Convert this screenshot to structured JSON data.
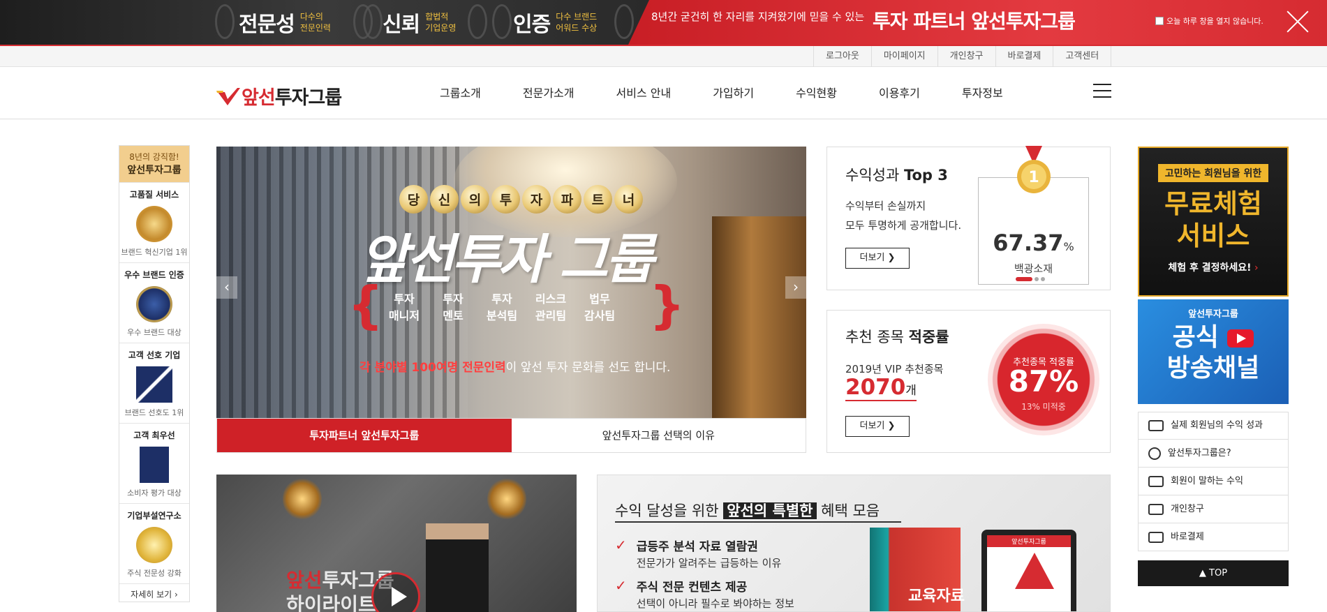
{
  "top_banner": {
    "items": [
      {
        "big": "전문성",
        "small": "다수의\n전문인력"
      },
      {
        "big": "신뢰",
        "small": "합법적\n기업운영"
      },
      {
        "big": "인증",
        "small": "다수 브랜드\n어워드 수상"
      }
    ],
    "message": "8년간 굳건히 한 자리를 지켜왔기에 믿을 수 있는",
    "brand": "투자 파트너 앞선투자그룹",
    "checkbox_label": "오늘 하루 창을 열지 않습니다."
  },
  "util_nav": [
    "로그아웃",
    "마이페이지",
    "개인창구",
    "바로결제",
    "고객센터"
  ],
  "logo": {
    "red": "앞선",
    "black": "투자그룹"
  },
  "gnb": [
    "그룹소개",
    "전문가소개",
    "서비스 안내",
    "가입하기",
    "수익현황",
    "이용후기",
    "투자정보"
  ],
  "left_quick": {
    "head_small": "8년의 강직함!",
    "head_big": "앞선투자그룹",
    "items": [
      {
        "title": "고품질 서비스",
        "sub": "브랜드 혁신기업 1위"
      },
      {
        "title": "우수 브랜드 인증",
        "sub": "우수 브랜드 대상"
      },
      {
        "title": "고객 선호 기업",
        "sub": "브랜드 선호도 1위"
      },
      {
        "title": "고객 최우선",
        "sub": "소비자 평가 대상"
      },
      {
        "title": "기업부설연구소",
        "sub": "주식 전문성 강화"
      }
    ],
    "more": "자세히 보기 ›"
  },
  "hero": {
    "badge_chars": [
      "당",
      "신",
      "의",
      "투",
      "자",
      "파",
      "트",
      "너"
    ],
    "title": "앞선투자 그룹",
    "teams": [
      "투자\n매니저",
      "투자\n멘토",
      "투자\n분석팀",
      "리스크\n관리팀",
      "법무\n감사팀"
    ],
    "sub_red": "각 분야별 100여명 전문인력",
    "sub_rest": "이 앞선 투자 문화를 선도 합니다.",
    "prev": "‹",
    "next": "›",
    "tabs": [
      "투자파트너 앞선투자그룹",
      "앞선투자그룹 선택의 이유"
    ]
  },
  "profit_top3": {
    "title_normal": "수익성과 ",
    "title_bold": "Top 3",
    "desc": "수익부터 손실까지\n모두 투명하게 공개합니다.",
    "more": "더보기 ❯",
    "rank_pct": "67.37",
    "rank_unit": "%",
    "rank_name": "백광소재",
    "medal_number": "1"
  },
  "hit_rate": {
    "title_normal": "추천 종목 ",
    "title_bold": "적중률",
    "year_label": "2019년 VIP 추천종목",
    "count": "2070",
    "count_unit": "개",
    "more": "더보기 ❯",
    "circle_label": "추천종목 적중률",
    "circle_pct": "87%",
    "circle_sub": "13% 미적중"
  },
  "video": {
    "title_red": "앞선",
    "title_rest": "투자그룹",
    "title2": "하이라이트"
  },
  "benefits": {
    "heading_pre": "수익 달성을 위한 ",
    "heading_hl": "앞선의 특별한",
    "heading_post": " 혜택 모음",
    "items": [
      {
        "title": "급등주 분석 자료 열람권",
        "desc": "전문가가 알려주는 급등하는 이유"
      },
      {
        "title": "주식 전문 컨텐츠 제공",
        "desc": "선택이 아니라 필수로 봐야하는 정보"
      }
    ],
    "book_label": "교육자료",
    "tablet_label": "앞선투자그룹"
  },
  "right_ad1": {
    "tag": "고민하는 회원님을 위한",
    "big": "무료체험\n서비스",
    "cta": "체험 후 결정하세요!",
    "cta_arrow": " ›"
  },
  "right_ad2": {
    "logo": "앞선투자그룹",
    "big_line1": "공식",
    "big_line2": "방송채널"
  },
  "right_list": [
    "실제 회원님의 수익 성과",
    "앞선투자그룹은?",
    "회원이 말하는 수익",
    "개인창구",
    "바로결제"
  ],
  "top_button": "▲ TOP"
}
